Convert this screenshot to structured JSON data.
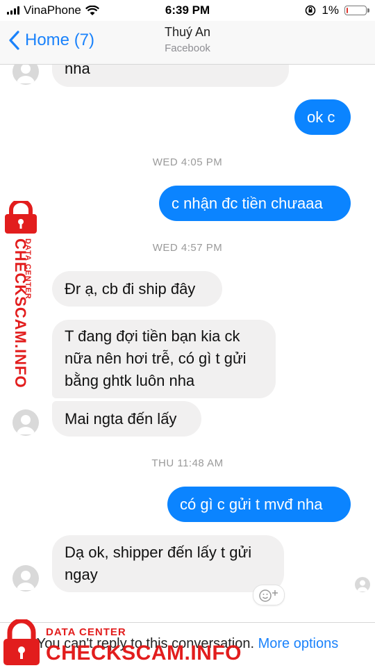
{
  "status_bar": {
    "carrier": "VinaPhone",
    "time": "6:39 PM",
    "battery": "1%",
    "battery_level": 0.01
  },
  "nav": {
    "back_label": "Home (7)",
    "contact_name": "Thuý An",
    "contact_source": "Facebook"
  },
  "messages": [
    {
      "type": "in",
      "text": "nha"
    },
    {
      "type": "out",
      "text": "ok c"
    },
    {
      "type": "timestamp",
      "text": "WED 4:05 PM"
    },
    {
      "type": "out",
      "text": "c nhận đc tiền chưaaa"
    },
    {
      "type": "timestamp",
      "text": "WED 4:57 PM"
    },
    {
      "type": "in",
      "text": "Đr ạ, cb đi ship đây"
    },
    {
      "type": "in",
      "lines": [
        "T đang đợi tiền bạn kia ck",
        "nữa nên hơi trễ, có gì t gửi",
        "bằng ghtk luôn nha"
      ]
    },
    {
      "type": "in",
      "text": "Mai ngta đến lấy"
    },
    {
      "type": "timestamp",
      "text": "THU 11:48 AM"
    },
    {
      "type": "out",
      "text": "có gì c gửi t mvđ nha"
    },
    {
      "type": "in",
      "lines": [
        "Dạ ok, shipper đến lấy t gửi",
        "ngay"
      ]
    }
  ],
  "footer": {
    "notice": "You can't reply to this conversation.",
    "link": "More options"
  },
  "watermark": {
    "side_top": "DATA CENTER",
    "side_main": "CHECKSCAM.INFO",
    "bottom_top": "DATA CENTER",
    "bottom_main": "CHECKSCAM.INFO",
    "color": "#e21d1d"
  },
  "colors": {
    "accent": "#1a82fb",
    "outgoing_bubble": "#0b84ff",
    "incoming_bubble": "#f1f0f0"
  }
}
